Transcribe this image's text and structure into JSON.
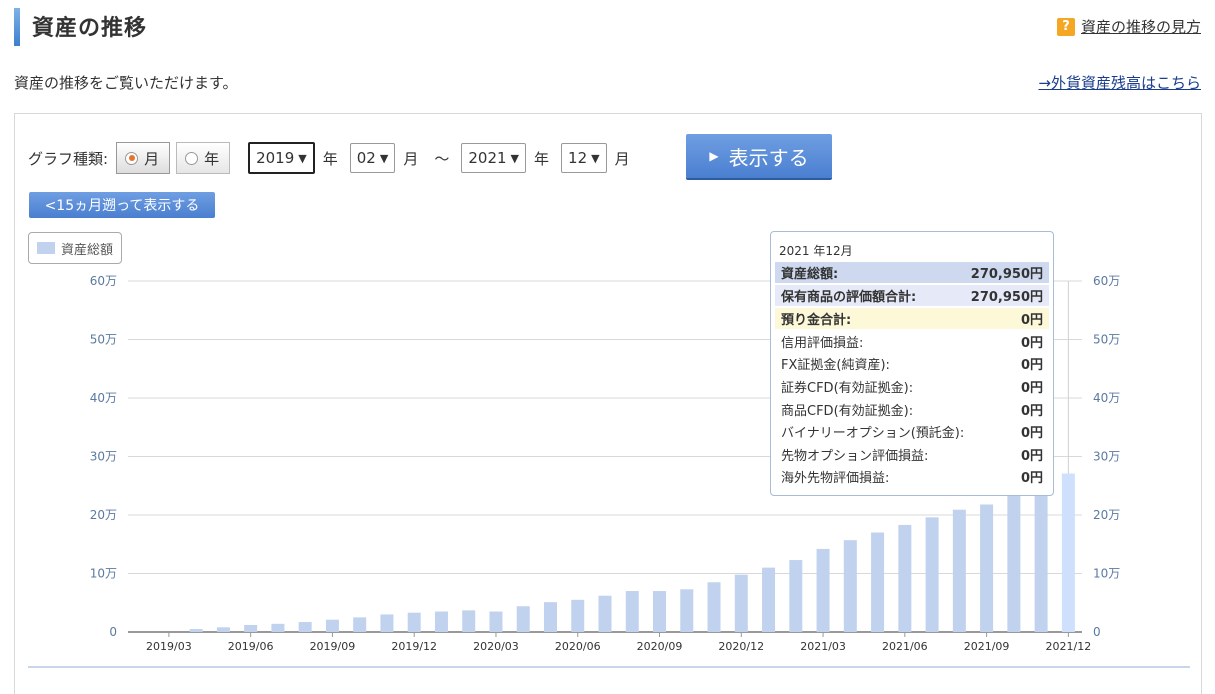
{
  "header": {
    "title": "資産の推移",
    "help_label": "資産の推移の見方",
    "help_icon": "question-icon"
  },
  "description": "資産の推移をご覧いただけます。",
  "fx_link": "→外貨資産残高はこちら",
  "controls": {
    "graph_type_label": "グラフ種類:",
    "month_label": "月",
    "year_label": "年",
    "start_year": "2019",
    "start_month": "02",
    "end_year": "2021",
    "end_month": "12",
    "year_unit": "年",
    "month_unit": "月",
    "tilde": "〜",
    "show_label": "表示する",
    "back_label": "<15ヵ月遡って表示する"
  },
  "legend": {
    "label": "資産総額",
    "color": "#c1d2ee"
  },
  "tooltip": {
    "title": "2021 年12月",
    "rows": [
      {
        "label": "資産総額:",
        "value": "270,950円"
      },
      {
        "label": "保有商品の評価額合計:",
        "value": "270,950円"
      },
      {
        "label": "預り金合計:",
        "value": "0円"
      },
      {
        "label": "信用評価損益:",
        "value": "0円"
      },
      {
        "label": "FX証拠金(純資産):",
        "value": "0円"
      },
      {
        "label": "証券CFD(有効証拠金):",
        "value": "0円"
      },
      {
        "label": "商品CFD(有効証拠金):",
        "value": "0円"
      },
      {
        "label": "バイナリーオプション(預託金):",
        "value": "0円"
      },
      {
        "label": "先物オプション評価損益:",
        "value": "0円"
      },
      {
        "label": "海外先物評価損益:",
        "value": "0円"
      }
    ]
  },
  "chart_data": {
    "type": "bar",
    "series": [
      {
        "name": "資産総額",
        "values": [
          0,
          0,
          5000,
          8000,
          12000,
          14000,
          17000,
          21000,
          25000,
          30000,
          33000,
          35000,
          37000,
          35000,
          44000,
          51000,
          55000,
          62000,
          70000,
          70000,
          73000,
          85000,
          98000,
          110000,
          123000,
          142000,
          157000,
          170000,
          183000,
          196000,
          209000,
          218000,
          235000,
          252000,
          270950
        ]
      }
    ],
    "categories": [
      "2019/02",
      "2019/03",
      "2019/04",
      "2019/05",
      "2019/06",
      "2019/07",
      "2019/08",
      "2019/09",
      "2019/10",
      "2019/11",
      "2019/12",
      "2020/01",
      "2020/02",
      "2020/03",
      "2020/04",
      "2020/05",
      "2020/06",
      "2020/07",
      "2020/08",
      "2020/09",
      "2020/10",
      "2020/11",
      "2020/12",
      "2021/01",
      "2021/02",
      "2021/03",
      "2021/04",
      "2021/05",
      "2021/06",
      "2021/07",
      "2021/08",
      "2021/09",
      "2021/10",
      "2021/11",
      "2021/12"
    ],
    "x_tick_labels": [
      "2019/03",
      "2019/06",
      "2019/09",
      "2019/12",
      "2020/03",
      "2020/06",
      "2020/09",
      "2020/12",
      "2021/03",
      "2021/06",
      "2021/09",
      "2021/12"
    ],
    "y_ticks": [
      0,
      100000,
      200000,
      300000,
      400000,
      500000,
      600000
    ],
    "y_tick_labels": [
      "0",
      "10万",
      "20万",
      "30万",
      "40万",
      "50万",
      "60万"
    ],
    "ylim": [
      0,
      600000
    ],
    "grid": true,
    "highlight_category": "2021/12",
    "colors": {
      "bar": "#c1d2ee",
      "highlight": "#cfe0fc"
    }
  }
}
